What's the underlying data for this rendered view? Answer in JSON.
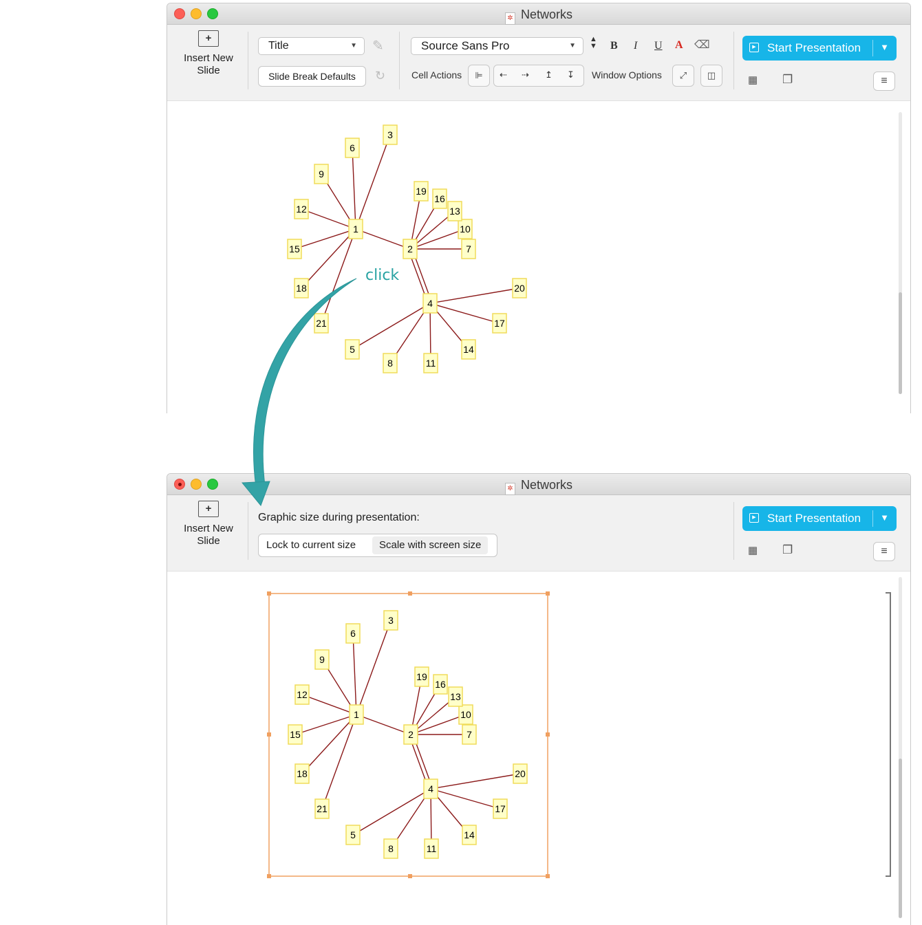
{
  "app": {
    "window_title": "Networks"
  },
  "toolbar_top": {
    "insert_label": "Insert New Slide",
    "style_select": "Title",
    "slide_break_button": "Slide Break Defaults",
    "font_select": "Source Sans Pro",
    "bold": "B",
    "italic": "I",
    "underline": "U",
    "text_color": "A",
    "cell_actions_label": "Cell Actions",
    "window_options_label": "Window Options",
    "present_label": "Start Presentation"
  },
  "toolbar_bottom": {
    "insert_label": "Insert New Slide",
    "heading": "Graphic size during presentation:",
    "options": [
      "Lock to current size",
      "Scale with screen size"
    ],
    "selected_option": "Scale with screen size",
    "present_label": "Start Presentation"
  },
  "annotation": {
    "label": "click",
    "color": "#2aa3a3"
  },
  "colors": {
    "accent": "#17b5e8",
    "edge": "#8b1a1a",
    "node_fill": "#ffffc9",
    "node_border": "#f0dc5a",
    "selection": "#f0a060"
  },
  "graph": {
    "nodes": [
      "1",
      "2",
      "3",
      "4",
      "5",
      "6",
      "7",
      "8",
      "9",
      "10",
      "11",
      "12",
      "13",
      "14",
      "15",
      "16",
      "17",
      "18",
      "19",
      "20",
      "21"
    ],
    "edges": [
      [
        "1",
        "3"
      ],
      [
        "1",
        "6"
      ],
      [
        "1",
        "9"
      ],
      [
        "1",
        "12"
      ],
      [
        "1",
        "15"
      ],
      [
        "1",
        "18"
      ],
      [
        "1",
        "21"
      ],
      [
        "1",
        "2"
      ],
      [
        "2",
        "19"
      ],
      [
        "2",
        "16"
      ],
      [
        "2",
        "13"
      ],
      [
        "2",
        "10"
      ],
      [
        "2",
        "7"
      ],
      [
        "2",
        "4"
      ],
      [
        "4",
        "20"
      ],
      [
        "4",
        "17"
      ],
      [
        "4",
        "14"
      ],
      [
        "4",
        "11"
      ],
      [
        "4",
        "8"
      ],
      [
        "4",
        "5"
      ]
    ],
    "double_edges": [
      [
        "2",
        "4"
      ]
    ]
  }
}
